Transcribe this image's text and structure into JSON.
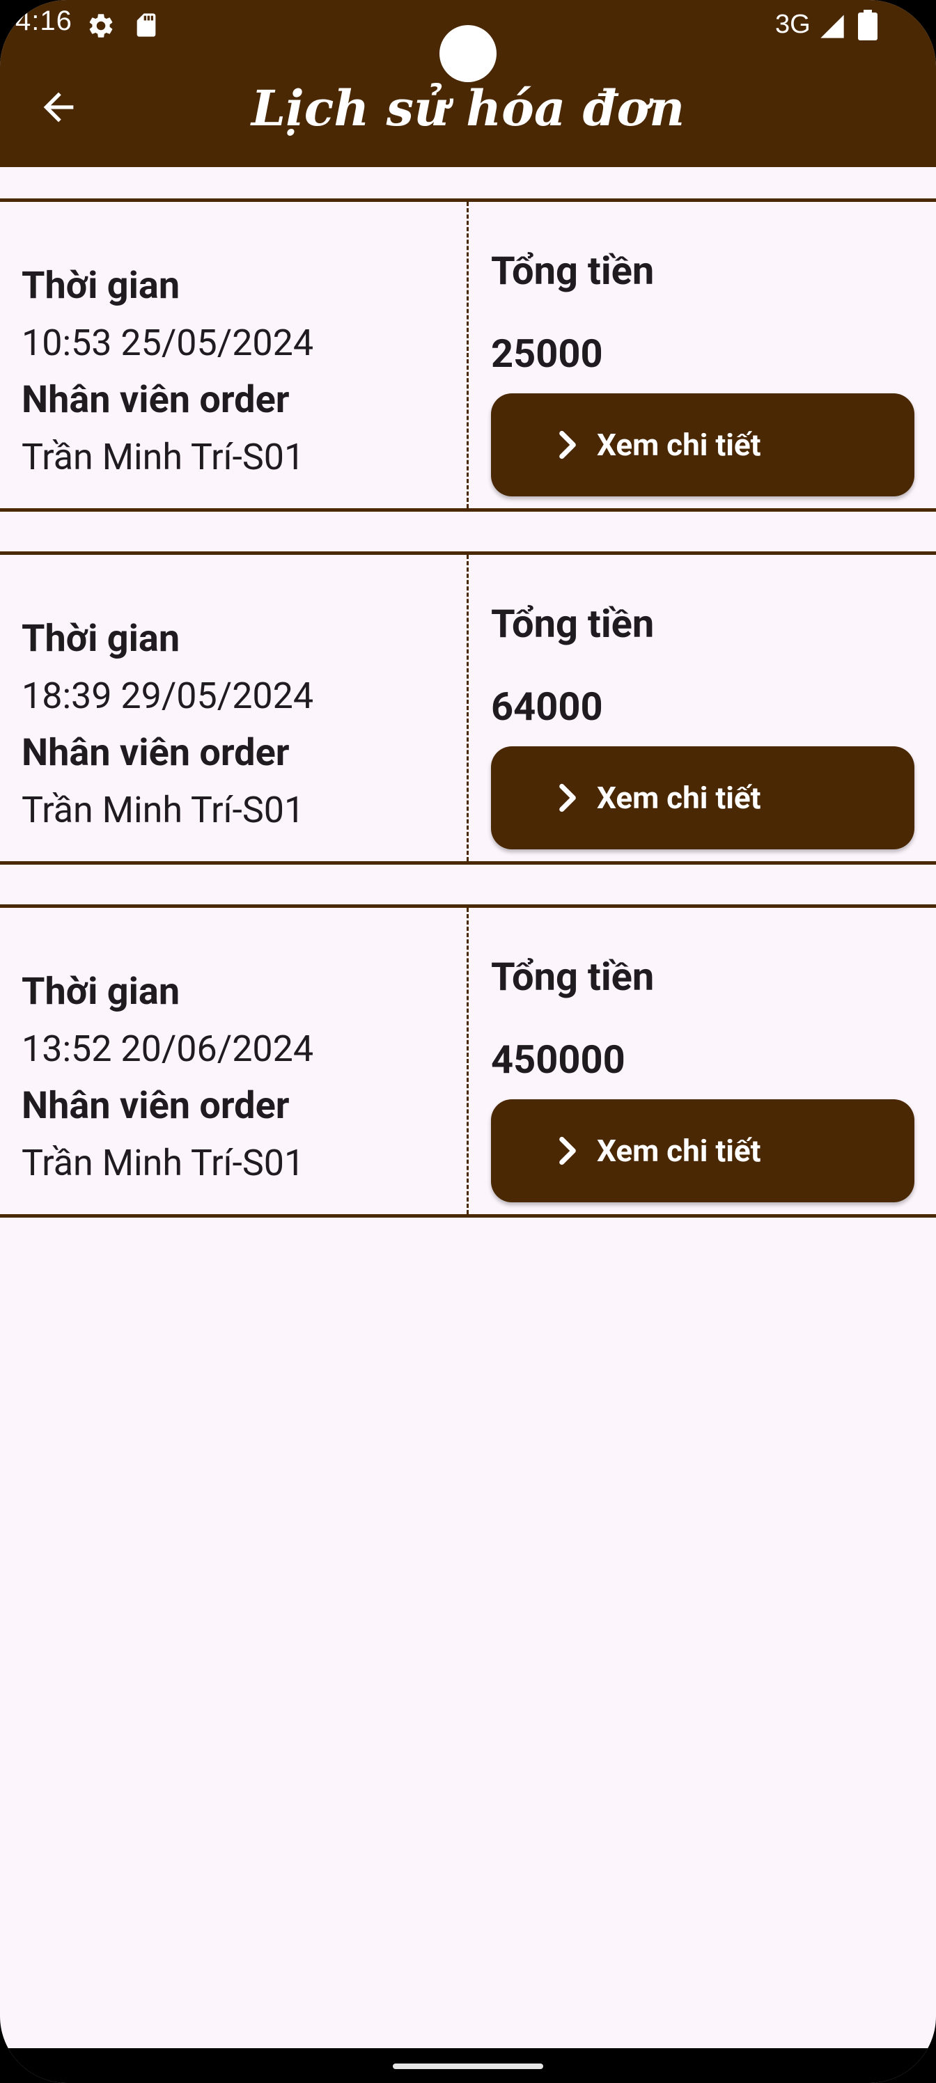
{
  "status_bar": {
    "time": "4:16",
    "network": "3G",
    "icons": [
      "gear-icon",
      "sd-card-icon",
      "signal-icon",
      "battery-icon"
    ]
  },
  "app_bar": {
    "title": "Lịch sử hóa đơn",
    "back_icon": "arrow-back-icon"
  },
  "bills": [
    {
      "time_label": "Thời gian",
      "time_value": "10:53 25/05/2024",
      "staff_label": "Nhân viên order",
      "staff_value": "Trần Minh Trí-S01",
      "total_label": "Tổng tiền",
      "total_value": "25000",
      "button_label": "Xem chi tiết"
    },
    {
      "time_label": "Thời gian",
      "time_value": "18:39 29/05/2024",
      "staff_label": "Nhân viên order",
      "staff_value": "Trần Minh Trí-S01",
      "total_label": "Tổng tiền",
      "total_value": "64000",
      "button_label": "Xem chi tiết"
    },
    {
      "time_label": "Thời gian",
      "time_value": "13:52 20/06/2024",
      "staff_label": "Nhân viên order",
      "staff_value": "Trần Minh Trí-S01",
      "total_label": "Tổng tiền",
      "total_value": "450000",
      "button_label": "Xem chi tiết"
    }
  ],
  "colors": {
    "primary": "#4a2804",
    "background": "#fcf5fc",
    "text": "#1f1b1f",
    "on_primary": "#ffffff"
  }
}
